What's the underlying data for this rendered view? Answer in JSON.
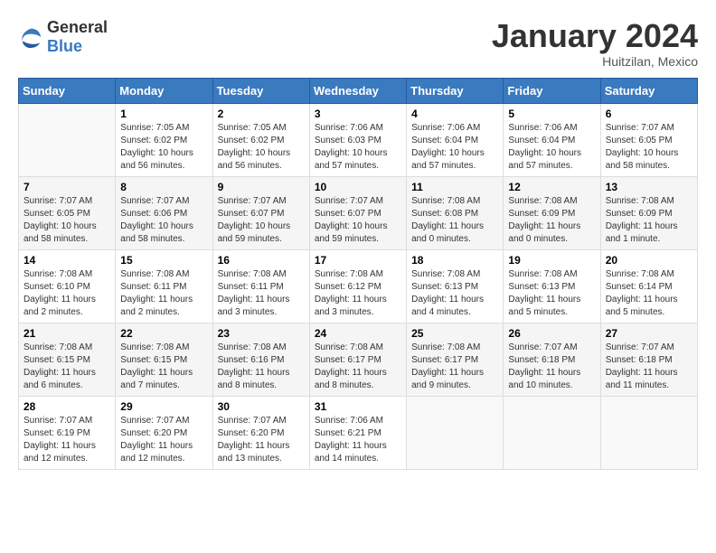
{
  "logo": {
    "general": "General",
    "blue": "Blue"
  },
  "header": {
    "month": "January 2024",
    "location": "Huitzilan, Mexico"
  },
  "weekdays": [
    "Sunday",
    "Monday",
    "Tuesday",
    "Wednesday",
    "Thursday",
    "Friday",
    "Saturday"
  ],
  "weeks": [
    [
      {
        "num": "",
        "sunrise": "",
        "sunset": "",
        "daylight": ""
      },
      {
        "num": "1",
        "sunrise": "Sunrise: 7:05 AM",
        "sunset": "Sunset: 6:02 PM",
        "daylight": "Daylight: 10 hours and 56 minutes."
      },
      {
        "num": "2",
        "sunrise": "Sunrise: 7:05 AM",
        "sunset": "Sunset: 6:02 PM",
        "daylight": "Daylight: 10 hours and 56 minutes."
      },
      {
        "num": "3",
        "sunrise": "Sunrise: 7:06 AM",
        "sunset": "Sunset: 6:03 PM",
        "daylight": "Daylight: 10 hours and 57 minutes."
      },
      {
        "num": "4",
        "sunrise": "Sunrise: 7:06 AM",
        "sunset": "Sunset: 6:04 PM",
        "daylight": "Daylight: 10 hours and 57 minutes."
      },
      {
        "num": "5",
        "sunrise": "Sunrise: 7:06 AM",
        "sunset": "Sunset: 6:04 PM",
        "daylight": "Daylight: 10 hours and 57 minutes."
      },
      {
        "num": "6",
        "sunrise": "Sunrise: 7:07 AM",
        "sunset": "Sunset: 6:05 PM",
        "daylight": "Daylight: 10 hours and 58 minutes."
      }
    ],
    [
      {
        "num": "7",
        "sunrise": "Sunrise: 7:07 AM",
        "sunset": "Sunset: 6:05 PM",
        "daylight": "Daylight: 10 hours and 58 minutes."
      },
      {
        "num": "8",
        "sunrise": "Sunrise: 7:07 AM",
        "sunset": "Sunset: 6:06 PM",
        "daylight": "Daylight: 10 hours and 58 minutes."
      },
      {
        "num": "9",
        "sunrise": "Sunrise: 7:07 AM",
        "sunset": "Sunset: 6:07 PM",
        "daylight": "Daylight: 10 hours and 59 minutes."
      },
      {
        "num": "10",
        "sunrise": "Sunrise: 7:07 AM",
        "sunset": "Sunset: 6:07 PM",
        "daylight": "Daylight: 10 hours and 59 minutes."
      },
      {
        "num": "11",
        "sunrise": "Sunrise: 7:08 AM",
        "sunset": "Sunset: 6:08 PM",
        "daylight": "Daylight: 11 hours and 0 minutes."
      },
      {
        "num": "12",
        "sunrise": "Sunrise: 7:08 AM",
        "sunset": "Sunset: 6:09 PM",
        "daylight": "Daylight: 11 hours and 0 minutes."
      },
      {
        "num": "13",
        "sunrise": "Sunrise: 7:08 AM",
        "sunset": "Sunset: 6:09 PM",
        "daylight": "Daylight: 11 hours and 1 minute."
      }
    ],
    [
      {
        "num": "14",
        "sunrise": "Sunrise: 7:08 AM",
        "sunset": "Sunset: 6:10 PM",
        "daylight": "Daylight: 11 hours and 2 minutes."
      },
      {
        "num": "15",
        "sunrise": "Sunrise: 7:08 AM",
        "sunset": "Sunset: 6:11 PM",
        "daylight": "Daylight: 11 hours and 2 minutes."
      },
      {
        "num": "16",
        "sunrise": "Sunrise: 7:08 AM",
        "sunset": "Sunset: 6:11 PM",
        "daylight": "Daylight: 11 hours and 3 minutes."
      },
      {
        "num": "17",
        "sunrise": "Sunrise: 7:08 AM",
        "sunset": "Sunset: 6:12 PM",
        "daylight": "Daylight: 11 hours and 3 minutes."
      },
      {
        "num": "18",
        "sunrise": "Sunrise: 7:08 AM",
        "sunset": "Sunset: 6:13 PM",
        "daylight": "Daylight: 11 hours and 4 minutes."
      },
      {
        "num": "19",
        "sunrise": "Sunrise: 7:08 AM",
        "sunset": "Sunset: 6:13 PM",
        "daylight": "Daylight: 11 hours and 5 minutes."
      },
      {
        "num": "20",
        "sunrise": "Sunrise: 7:08 AM",
        "sunset": "Sunset: 6:14 PM",
        "daylight": "Daylight: 11 hours and 5 minutes."
      }
    ],
    [
      {
        "num": "21",
        "sunrise": "Sunrise: 7:08 AM",
        "sunset": "Sunset: 6:15 PM",
        "daylight": "Daylight: 11 hours and 6 minutes."
      },
      {
        "num": "22",
        "sunrise": "Sunrise: 7:08 AM",
        "sunset": "Sunset: 6:15 PM",
        "daylight": "Daylight: 11 hours and 7 minutes."
      },
      {
        "num": "23",
        "sunrise": "Sunrise: 7:08 AM",
        "sunset": "Sunset: 6:16 PM",
        "daylight": "Daylight: 11 hours and 8 minutes."
      },
      {
        "num": "24",
        "sunrise": "Sunrise: 7:08 AM",
        "sunset": "Sunset: 6:17 PM",
        "daylight": "Daylight: 11 hours and 8 minutes."
      },
      {
        "num": "25",
        "sunrise": "Sunrise: 7:08 AM",
        "sunset": "Sunset: 6:17 PM",
        "daylight": "Daylight: 11 hours and 9 minutes."
      },
      {
        "num": "26",
        "sunrise": "Sunrise: 7:07 AM",
        "sunset": "Sunset: 6:18 PM",
        "daylight": "Daylight: 11 hours and 10 minutes."
      },
      {
        "num": "27",
        "sunrise": "Sunrise: 7:07 AM",
        "sunset": "Sunset: 6:18 PM",
        "daylight": "Daylight: 11 hours and 11 minutes."
      }
    ],
    [
      {
        "num": "28",
        "sunrise": "Sunrise: 7:07 AM",
        "sunset": "Sunset: 6:19 PM",
        "daylight": "Daylight: 11 hours and 12 minutes."
      },
      {
        "num": "29",
        "sunrise": "Sunrise: 7:07 AM",
        "sunset": "Sunset: 6:20 PM",
        "daylight": "Daylight: 11 hours and 12 minutes."
      },
      {
        "num": "30",
        "sunrise": "Sunrise: 7:07 AM",
        "sunset": "Sunset: 6:20 PM",
        "daylight": "Daylight: 11 hours and 13 minutes."
      },
      {
        "num": "31",
        "sunrise": "Sunrise: 7:06 AM",
        "sunset": "Sunset: 6:21 PM",
        "daylight": "Daylight: 11 hours and 14 minutes."
      },
      {
        "num": "",
        "sunrise": "",
        "sunset": "",
        "daylight": ""
      },
      {
        "num": "",
        "sunrise": "",
        "sunset": "",
        "daylight": ""
      },
      {
        "num": "",
        "sunrise": "",
        "sunset": "",
        "daylight": ""
      }
    ]
  ]
}
